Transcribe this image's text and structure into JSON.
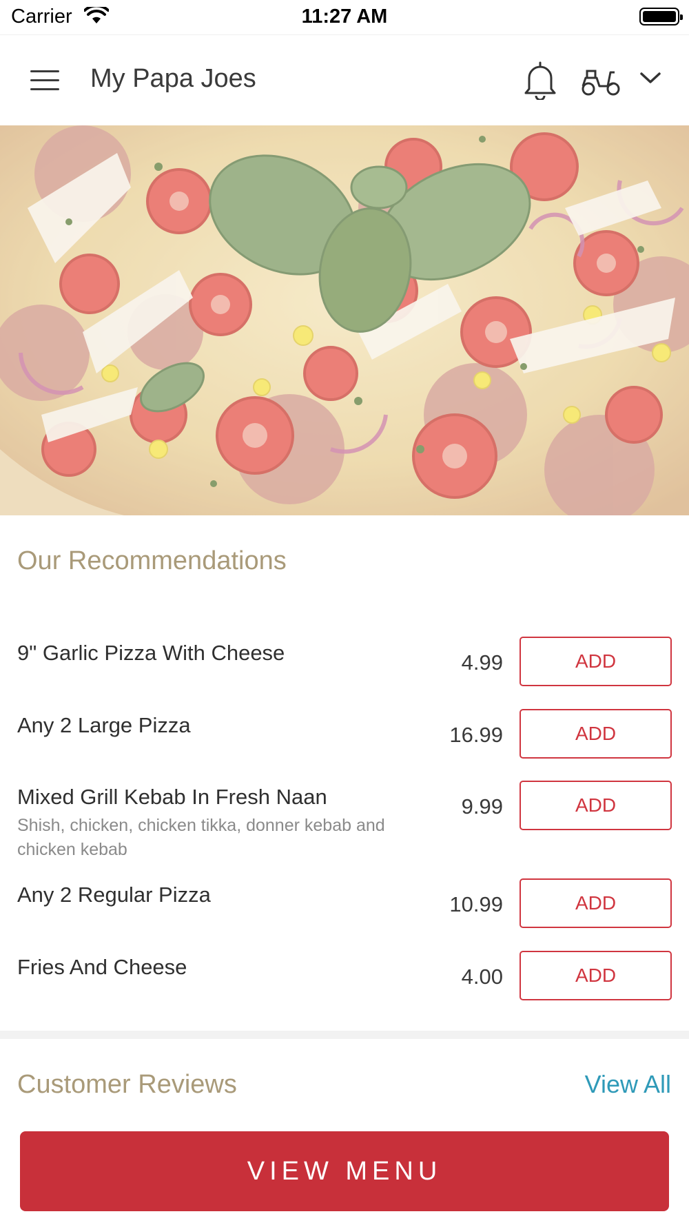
{
  "status_bar": {
    "carrier": "Carrier",
    "time": "11:27 AM"
  },
  "header": {
    "title": "My Papa Joes",
    "icons": [
      "menu-icon",
      "bell-icon",
      "delivery-scooter-icon",
      "chevron-down-icon"
    ]
  },
  "recommendations": {
    "title": "Our Recommendations",
    "items": [
      {
        "name": "9\" Garlic Pizza With Cheese",
        "description": "",
        "price": "4.99",
        "button": "ADD"
      },
      {
        "name": "Any 2 Large Pizza",
        "description": "",
        "price": "16.99",
        "button": "ADD"
      },
      {
        "name": "Mixed Grill Kebab In Fresh Naan",
        "description": "Shish, chicken, chicken tikka, donner kebab and chicken kebab",
        "price": "9.99",
        "button": "ADD"
      },
      {
        "name": "Any 2 Regular Pizza",
        "description": "",
        "price": "10.99",
        "button": "ADD"
      },
      {
        "name": "Fries And Cheese",
        "description": "",
        "price": "4.00",
        "button": "ADD"
      }
    ]
  },
  "reviews": {
    "title": "Customer Reviews",
    "view_all": "View All"
  },
  "footer": {
    "view_menu": "VIEW MENU"
  },
  "colors": {
    "accent": "#c8303a",
    "section_title": "#a99a79",
    "link": "#2f9ab8"
  }
}
